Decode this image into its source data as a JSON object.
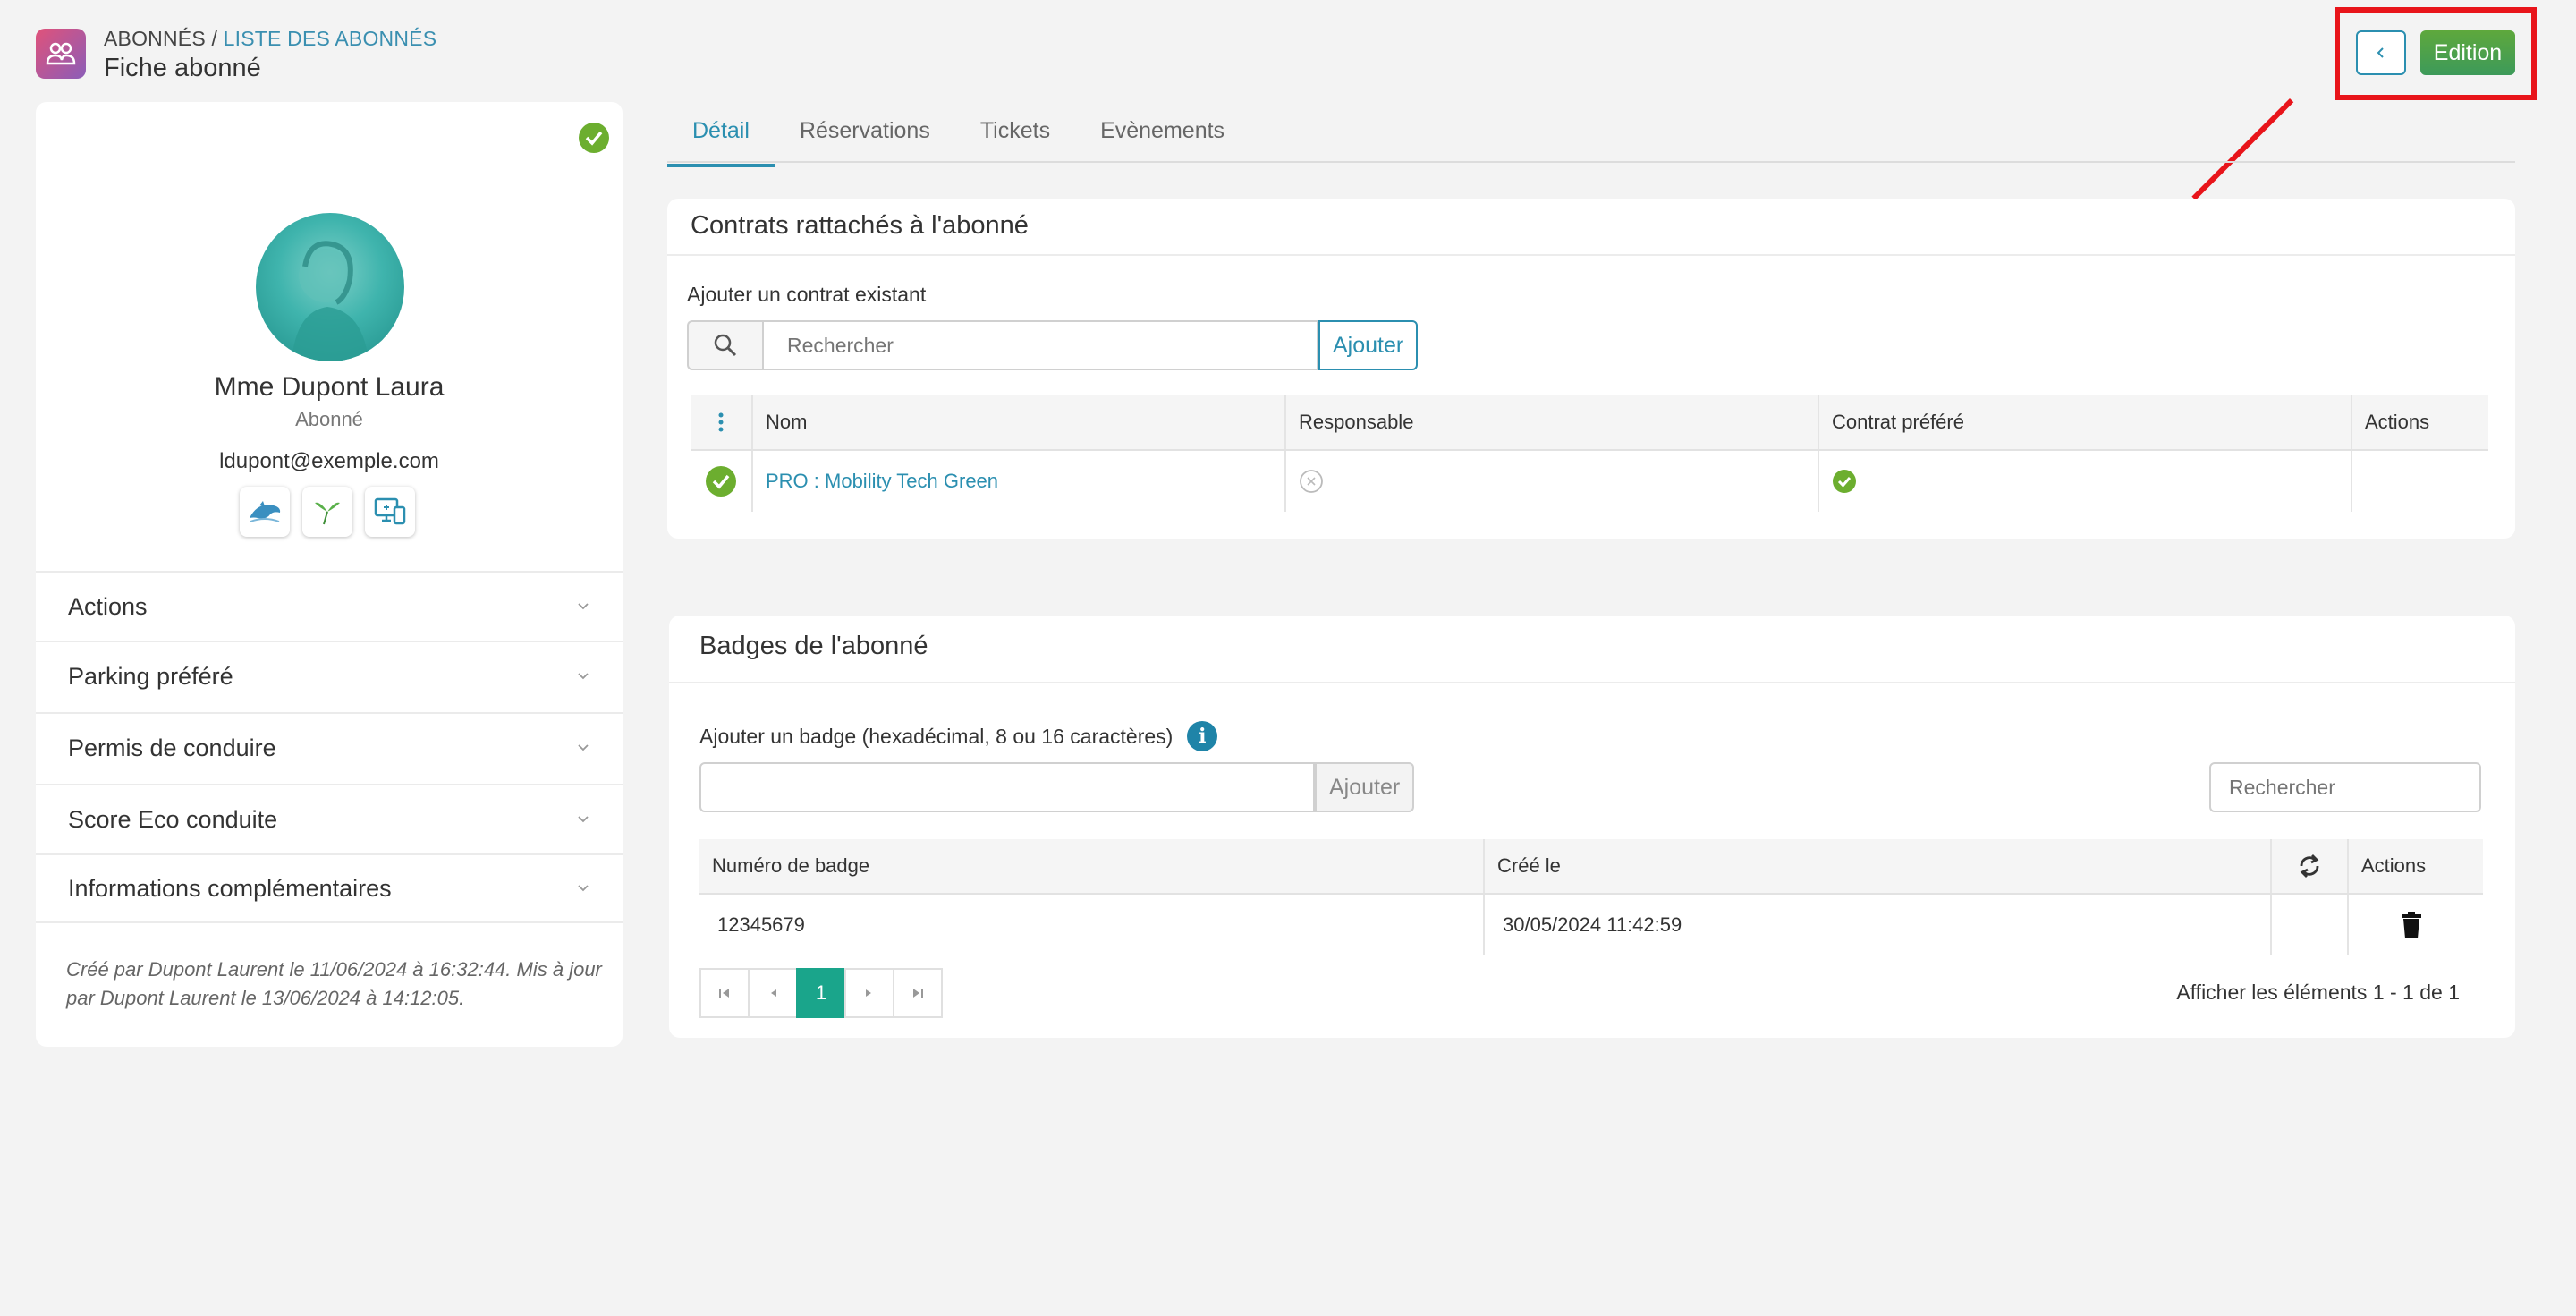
{
  "header": {
    "breadcrumb_root": "ABONNÉS",
    "breadcrumb_sep": " / ",
    "breadcrumb_link": "LISTE DES ABONNÉS",
    "title": "Fiche abonné",
    "back_label": "<",
    "edit_label": "Edition"
  },
  "profile": {
    "name": "Mme Dupont Laura",
    "role": "Abonné",
    "email": "ldupont@exemple.com",
    "apps": [
      "dolphin-app-icon",
      "bird-app-icon",
      "devices-app-icon"
    ]
  },
  "accordion": [
    {
      "label": "Actions"
    },
    {
      "label": "Parking préféré"
    },
    {
      "label": "Permis de conduire"
    },
    {
      "label": "Score Eco conduite"
    },
    {
      "label": "Informations complémentaires"
    }
  ],
  "audit": "Créé par Dupont Laurent le 11/06/2024 à 16:32:44. Mis à jour par Dupont Laurent le 13/06/2024 à 14:12:05.",
  "tabs": [
    {
      "label": "Détail",
      "active": true
    },
    {
      "label": "Réservations",
      "active": false
    },
    {
      "label": "Tickets",
      "active": false
    },
    {
      "label": "Evènements",
      "active": false
    }
  ],
  "contracts": {
    "title": "Contrats rattachés à l'abonné",
    "add_label": "Ajouter un contrat existant",
    "search_placeholder": "Rechercher",
    "add_button": "Ajouter",
    "columns": [
      "Nom",
      "Responsable",
      "Contrat préféré",
      "Actions"
    ],
    "rows": [
      {
        "name": "PRO : Mobility Tech Green",
        "responsable": false,
        "prefere": true
      }
    ]
  },
  "badges": {
    "title": "Badges de l'abonné",
    "add_label": "Ajouter un badge (hexadécimal, 8 ou 16 caractères)",
    "info": "i",
    "add_button": "Ajouter",
    "search_placeholder": "Rechercher",
    "columns": [
      "Numéro de badge",
      "Créé le",
      "Actions"
    ],
    "rows": [
      {
        "number": "12345679",
        "created": "30/05/2024 11:42:59"
      }
    ],
    "pager_current": "1",
    "pager_info": "Afficher les éléments 1 - 1 de 1"
  },
  "colors": {
    "primary": "#2b8fb0",
    "success": "#6cae2f",
    "highlight": "#e8141a",
    "pager_active": "#1aa58b"
  }
}
